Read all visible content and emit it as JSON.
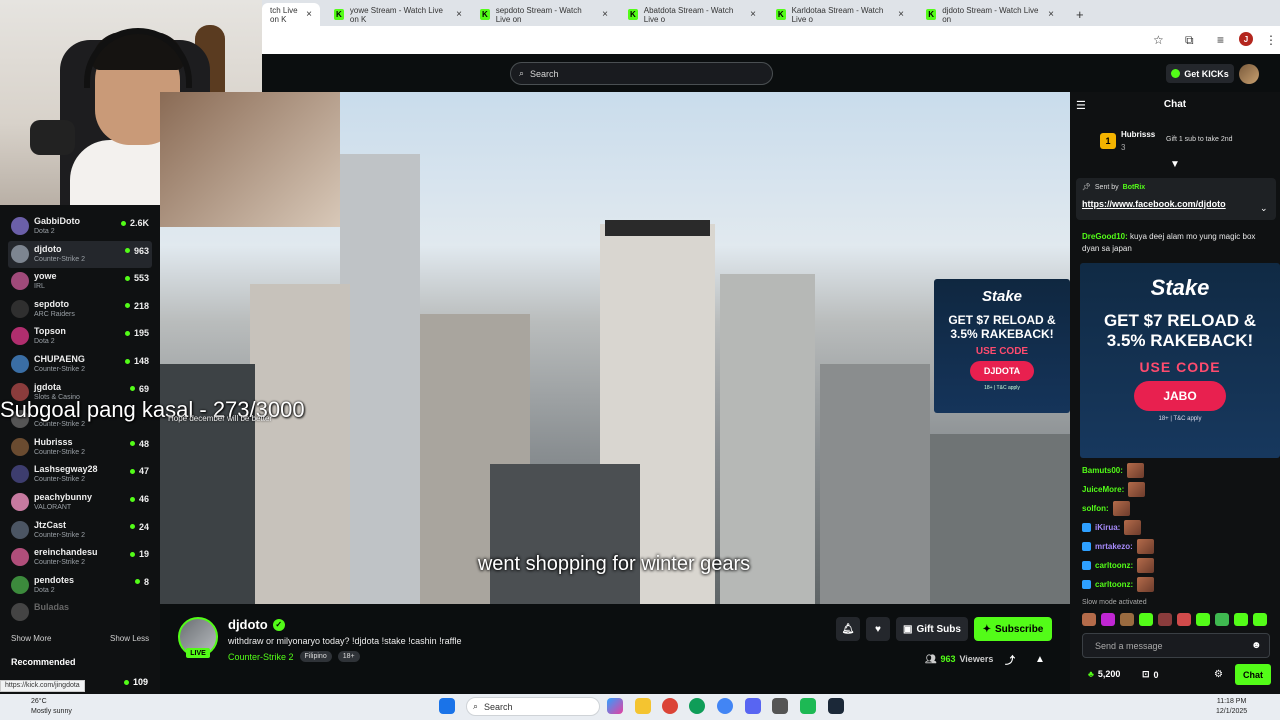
{
  "browser": {
    "tabs": [
      {
        "title": "tch Live on K",
        "active": true
      },
      {
        "title": "yowe Stream - Watch Live on K"
      },
      {
        "title": "sepdoto Stream - Watch Live on"
      },
      {
        "title": "Abatdota Stream - Watch Live o"
      },
      {
        "title": "Karldotaa Stream - Watch Live o"
      },
      {
        "title": "djdoto Stream - Watch Live on"
      }
    ],
    "new_tab": "+",
    "profile_initial": "J"
  },
  "header": {
    "search_placeholder": "Search",
    "get_kicks_label": "Get KICKs"
  },
  "sidebar": {
    "channels": [
      {
        "name": "GabbiDoto",
        "game": "Dota 2",
        "viewers": "2.6K",
        "color": "#6b5fa8"
      },
      {
        "name": "djdoto",
        "game": "Counter-Strike 2",
        "viewers": "963",
        "color": "#7d8590",
        "selected": true
      },
      {
        "name": "yowe",
        "game": "IRL",
        "viewers": "553",
        "color": "#a04a7a"
      },
      {
        "name": "sepdoto",
        "game": "ARC Raiders",
        "viewers": "218",
        "color": "#2f2f2f"
      },
      {
        "name": "Topson",
        "game": "Dota 2",
        "viewers": "195",
        "color": "#b02e6e"
      },
      {
        "name": "CHUPAENG",
        "game": "Counter-Strike 2",
        "viewers": "148",
        "color": "#3a6ea5"
      },
      {
        "name": "jgdota",
        "game": "Slots & Casino",
        "viewers": "69",
        "color": "#8a3c3c"
      },
      {
        "name": "",
        "game": "Counter-Strike 2",
        "viewers": "",
        "color": "#555"
      },
      {
        "name": "Hubrisss",
        "game": "Counter-Strike 2",
        "viewers": "48",
        "color": "#6a4b30"
      },
      {
        "name": "Lashsegway28",
        "game": "Counter-Strike 2",
        "viewers": "47",
        "color": "#3d3d6e"
      },
      {
        "name": "peachybunny",
        "game": "VALORANT",
        "viewers": "46",
        "color": "#c77aa0"
      },
      {
        "name": "JtzCast",
        "game": "Counter-Strike 2",
        "viewers": "24",
        "color": "#4b5563"
      },
      {
        "name": "ereinchandesu",
        "game": "Counter-Strike 2",
        "viewers": "19",
        "color": "#b04e7a"
      },
      {
        "name": "pendotes",
        "game": "Dota 2",
        "viewers": "8",
        "color": "#3c8a3c"
      },
      {
        "name": "Buladas",
        "game": "",
        "viewers": "",
        "color": "#444"
      }
    ],
    "show_more": "Show More",
    "show_less": "Show Less",
    "recommended_label": "Recommended",
    "recommended_viewers": "109"
  },
  "status_url": "https://kick.com/jingdota",
  "overlay": {
    "subgoal": "Subgoal pang kasal - 273/3000",
    "subgoal_small": "Hope december will be better",
    "caption": "went shopping for winter gears"
  },
  "stake_video": {
    "logo": "Stake",
    "line1": "GET $7 RELOAD &",
    "line2": "3.5% RAKEBACK!",
    "use_code": "USE CODE",
    "code": "DJDOTA",
    "tc": "18+ | T&C apply"
  },
  "stream": {
    "streamer": "djdoto",
    "live_badge": "LIVE",
    "title": "withdraw or milyonaryo today? !djdota !stake !cashin !raffle",
    "category": "Counter-Strike 2",
    "tags": [
      "Filipino",
      "18+"
    ],
    "gift_subs_label": "Gift Subs",
    "subscribe_label": "Subscribe",
    "viewers_count": "963",
    "viewers_label": "Viewers"
  },
  "chat": {
    "title": "Chat",
    "top_gifter": {
      "rank": "1",
      "name": "Hubrisss",
      "count": "3"
    },
    "gift_cta": "Gift 1 sub to take 2nd",
    "pinned_sent_by": "Sent by",
    "pinned_bot": "BotRix",
    "pinned_link": "https://www.facebook.com/djdoto",
    "first_message": {
      "user": "DreGood10:",
      "text": "kuya deej alam mo yung magic box dyan sa japan"
    },
    "stake": {
      "logo": "Stake",
      "line1": "GET $7 RELOAD &",
      "line2": "3.5% RAKEBACK!",
      "use_code": "USE CODE",
      "code": "JABO",
      "tc": "18+ | T&C apply"
    },
    "emote_users": [
      {
        "user": "Bamuts00:",
        "color": "#53fc18"
      },
      {
        "user": "JuiceMore:",
        "color": "#53fc18"
      },
      {
        "user": "solfon:",
        "color": "#53fc18"
      },
      {
        "user": "iKirua:",
        "color": "#a78bfa"
      },
      {
        "user": "mrtakezo:",
        "color": "#a78bfa"
      },
      {
        "user": "carltoonz:",
        "color": "#53fc18"
      },
      {
        "user": "carltoonz:",
        "color": "#53fc18"
      }
    ],
    "slow_mode": "Slow mode activated",
    "input_placeholder": "Send a message",
    "kicks_balance": "5,200",
    "points": "0",
    "send_label": "Chat"
  },
  "taskbar": {
    "temp": "26°C",
    "weather": "Mostly sunny",
    "search_label": "Search",
    "time": "11:18 PM",
    "date": "12/1/2025"
  }
}
